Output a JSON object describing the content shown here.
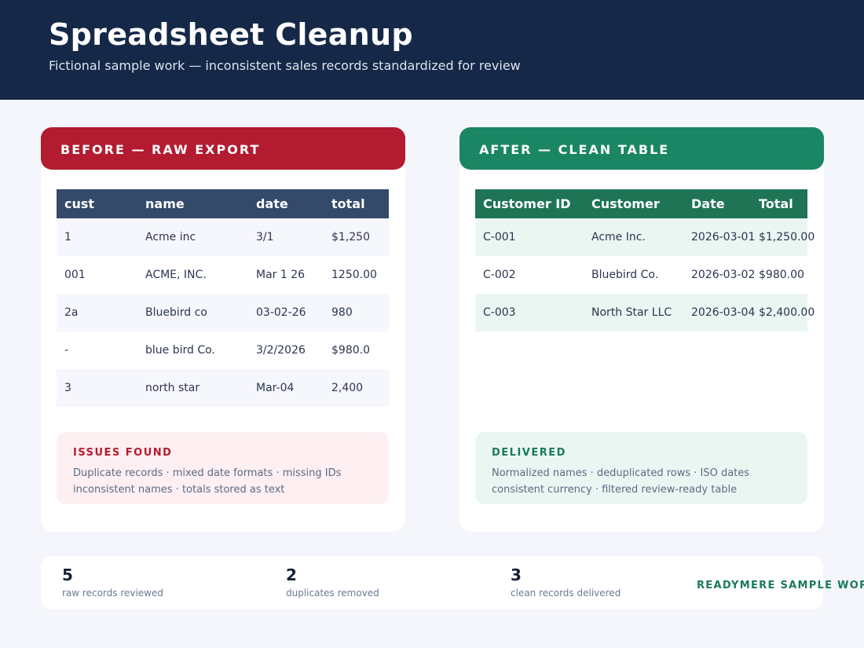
{
  "header": {
    "title": "Spreadsheet Cleanup",
    "subtitle": "Fictional sample work — inconsistent sales records standardized for review",
    "background": "#152848"
  },
  "before": {
    "heading": "BEFORE — RAW EXPORT",
    "accent": "#b31b30",
    "columns": [
      "cust",
      "name",
      "date",
      "total"
    ],
    "rows": [
      [
        "1",
        "Acme inc",
        "3/1",
        "$1,250"
      ],
      [
        "001",
        "ACME, INC.",
        "Mar 1 26",
        "1250.00"
      ],
      [
        "2a",
        "Bluebird co",
        "03-02-26",
        "980"
      ],
      [
        "-",
        "blue bird Co.",
        "3/2/2026",
        "$980.0"
      ],
      [
        "3",
        "north star",
        "Mar-04",
        "2,400"
      ]
    ],
    "note_title": "ISSUES FOUND",
    "note_line1": "Duplicate records · mixed date formats · missing IDs",
    "note_line2": "inconsistent names · totals stored as text"
  },
  "after": {
    "heading": "AFTER — CLEAN TABLE",
    "accent": "#1b8663",
    "columns": [
      "Customer ID",
      "Customer",
      "Date",
      "Total"
    ],
    "rows": [
      [
        "C-001",
        "Acme Inc.",
        "2026-03-01",
        "$1,250.00"
      ],
      [
        "C-002",
        "Bluebird Co.",
        "2026-03-02",
        "$980.00"
      ],
      [
        "C-003",
        "North Star LLC",
        "2026-03-04",
        "$2,400.00"
      ]
    ],
    "note_title": "DELIVERED",
    "note_line1": "Normalized names · deduplicated rows · ISO dates",
    "note_line2": "consistent currency · filtered review-ready table"
  },
  "stats": [
    {
      "value": "5",
      "label": "raw records reviewed"
    },
    {
      "value": "2",
      "label": "duplicates removed"
    },
    {
      "value": "3",
      "label": "clean records delivered"
    }
  ],
  "brand": "READYMERE SAMPLE WORK"
}
